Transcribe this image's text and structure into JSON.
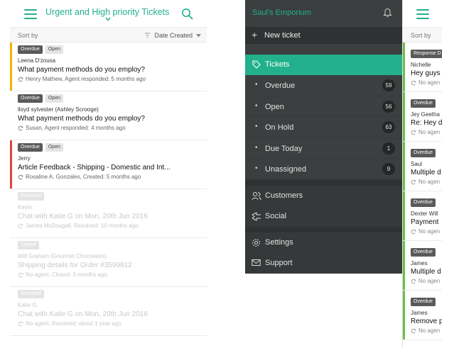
{
  "left": {
    "title": "Urgent and High priority Tickets",
    "sort_label": "Sort by",
    "sort_value": "Date Created",
    "colors": {
      "accent": "#23b08c",
      "urgent": "#f0b400",
      "high": "#e0443b"
    },
    "tickets": [
      {
        "badges": [
          "Overdue",
          "Open"
        ],
        "name": "Leena D'zousa",
        "subject": "What payment methods do you employ?",
        "meta": "Henry Mathew, Agent responded: 5 months ago",
        "bar": "#f0b400",
        "dim": false
      },
      {
        "badges": [
          "Overdue",
          "Open"
        ],
        "name": "lloyd sylvester (Ashley Scrooge)",
        "subject": "What payment methods do you employ?",
        "meta": "Susan, Agent responded: 4 months ago",
        "bar": "",
        "dim": false
      },
      {
        "badges": [
          "Overdue",
          "Open"
        ],
        "name": "Jerry",
        "subject": "Article Feedback - Shipping - Domestic and Int...",
        "meta": "Rosaline A. Gonzales, Created: 5 months ago",
        "bar": "#e0443b",
        "dim": false
      },
      {
        "badges": [
          "Resolved"
        ],
        "name": "Kevin",
        "subject": "Chat with Katie G on Mon, 20th Jun 2016",
        "meta": "James McDougall, Resolved: 10 months ago",
        "bar": "",
        "dim": true
      },
      {
        "badges": [
          "Closed"
        ],
        "name": "Will Graham (Gourmet Chocolates)",
        "subject": "Shipping details for Order #3599812",
        "meta": "No agent, Closed: 3 months ago",
        "bar": "",
        "dim": true
      },
      {
        "badges": [
          "Resolved"
        ],
        "name": "Katie G",
        "subject": "Chat with Katie G on Mon, 20th Jun 2016",
        "meta": "No agent, Resolved: about 1 year ago",
        "bar": "",
        "dim": true
      }
    ]
  },
  "menu": {
    "store_name": "Saul's Emporium",
    "new_ticket": "New ticket",
    "tickets": "Tickets",
    "sub_items": [
      {
        "label": "Overdue",
        "count": "59"
      },
      {
        "label": "Open",
        "count": "56"
      },
      {
        "label": "On Hold",
        "count": "63"
      },
      {
        "label": "Due Today",
        "count": "1"
      },
      {
        "label": "Unassigned",
        "count": "9"
      }
    ],
    "customers": "Customers",
    "social": "Social",
    "settings": "Settings",
    "support": "Support"
  },
  "right": {
    "sort_label": "Sort by",
    "tickets": [
      {
        "badge": "Response D",
        "name": "Nichelle",
        "subject": "Hey guys",
        "meta": "No agen"
      },
      {
        "badge": "Overdue",
        "name": "Jey Geetha",
        "subject": "Re: Hey d",
        "meta": "No agen"
      },
      {
        "badge": "Overdue",
        "name": "Saul",
        "subject": "Multiple d",
        "meta": "No agen"
      },
      {
        "badge": "Overdue",
        "name": "Dexter Will",
        "subject": "Payment",
        "meta": "No agen"
      },
      {
        "badge": "Overdue",
        "name": "James",
        "subject": "Multiple d",
        "meta": "No agen"
      },
      {
        "badge": "Overdue",
        "name": "James",
        "subject": "Remove p",
        "meta": "No agen"
      }
    ]
  }
}
